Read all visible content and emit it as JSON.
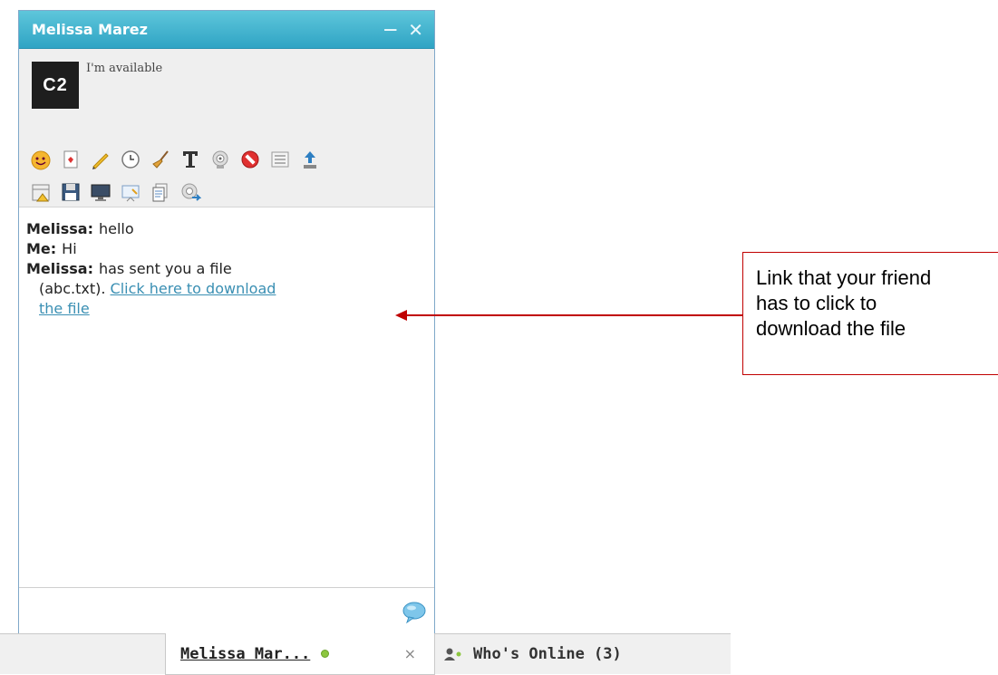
{
  "chat": {
    "title": "Melissa Marez",
    "minimize_label": "—",
    "close_label": "✕",
    "avatar_text": "C2",
    "status": "I'm available",
    "toolbar_row1": [
      "smiley-icon",
      "card-icon",
      "pencil-icon",
      "clock-icon",
      "broom-icon",
      "text-format-icon",
      "webcam-icon",
      "block-icon",
      "list-icon",
      "upload-icon"
    ],
    "toolbar_row2": [
      "calendar-icon",
      "save-icon",
      "monitor-icon",
      "whiteboard-icon",
      "document-icon",
      "webcam-share-icon"
    ],
    "messages": {
      "m1": {
        "sender": "Melissa:",
        "text": "hello"
      },
      "m2": {
        "sender": "Me:",
        "text": "Hi"
      },
      "m3": {
        "sender": "Melissa:",
        "text": "has sent you a file",
        "cont": "(abc.txt).",
        "link": "Click here to download",
        "link2": "the file"
      }
    }
  },
  "taskbar": {
    "chat_tab_label": "Melissa Mar...",
    "chat_tab_close": "×",
    "whos_online_label": "Who's Online (3)"
  },
  "callout": {
    "line1": "Link that your friend",
    "line2": "has to click to",
    "line3": "download the file"
  },
  "colors": {
    "header": "#2fa4c4",
    "link": "#3a8fb3",
    "callout_border": "#c00000",
    "online": "#8cc63f"
  }
}
